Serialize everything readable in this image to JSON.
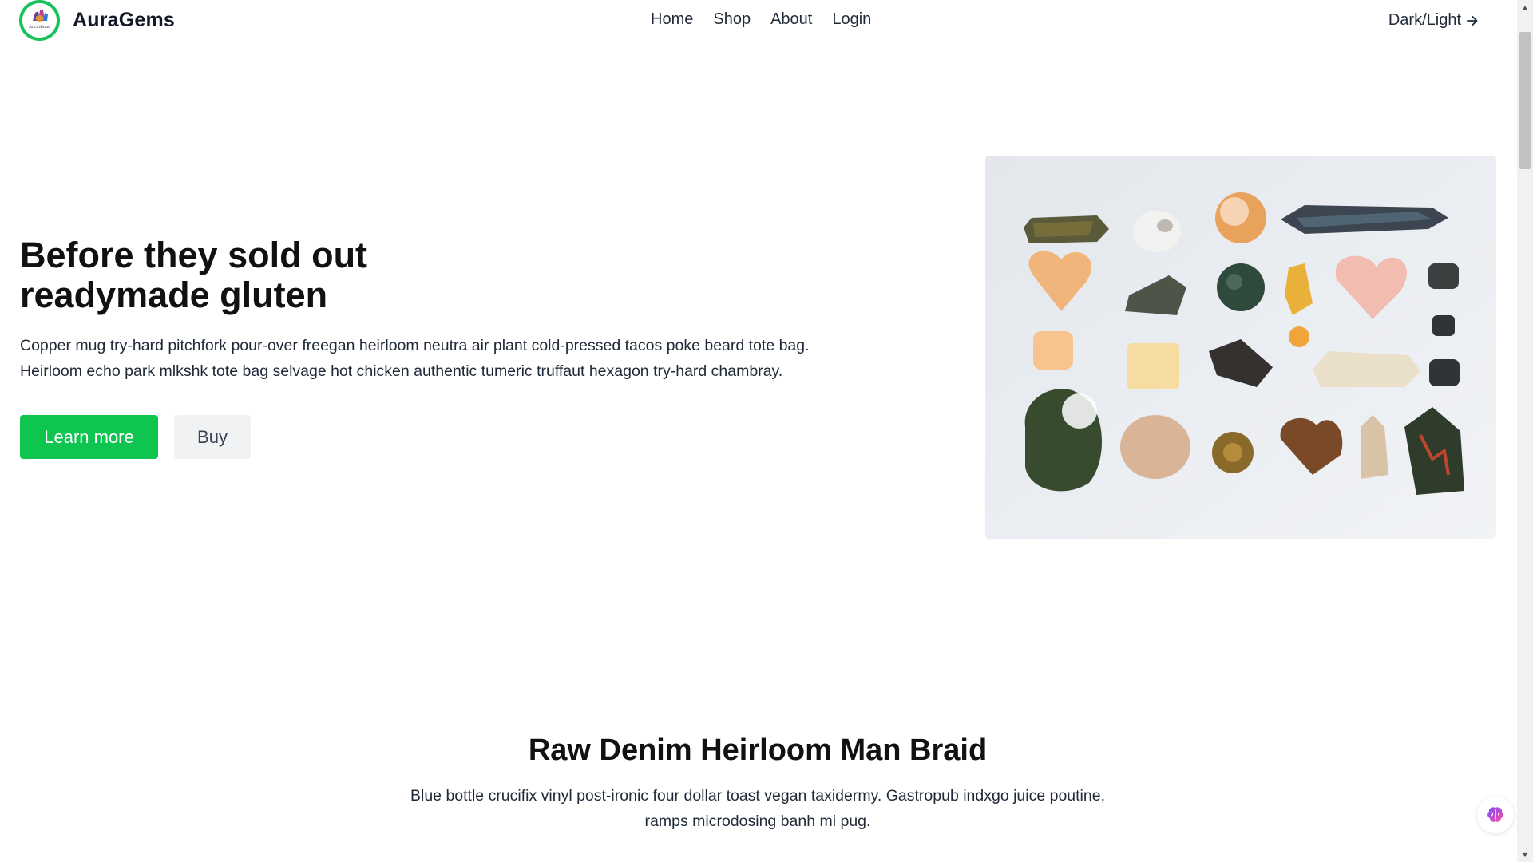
{
  "header": {
    "brand_name": "AuraGems",
    "logo_text": "AuraGems",
    "nav": [
      "Home",
      "Shop",
      "About",
      "Login"
    ],
    "theme_toggle": "Dark/Light",
    "theme_toggle_icon": "arrow-right-icon"
  },
  "hero": {
    "title_line1": "Before they sold out",
    "title_line2": "readymade gluten",
    "text_line1": "Copper mug try-hard pitchfork pour-over freegan heirloom neutra air plant cold-pressed tacos poke beard tote bag.",
    "text_line2": "Heirloom echo park mlkshk tote bag selvage hot chicken authentic tumeric truffaut hexagon try-hard chambray.",
    "primary_button": "Learn more",
    "secondary_button": "Buy",
    "image": "crystals-gemstones-photo"
  },
  "section": {
    "title": "Raw Denim Heirloom Man Braid",
    "text_line1": "Blue bottle crucifix vinyl post-ironic four dollar toast vegan taxidermy. Gastropub indxgo juice poutine,",
    "text_line2": "ramps microdosing banh mi pug."
  },
  "colors": {
    "accent": "#0dc54f",
    "logo_ring": "#16c35a",
    "secondary_button_bg": "#f1f2f4",
    "image_bg": "#e9ecf0"
  },
  "floating_widget": {
    "icon": "brain-icon"
  }
}
